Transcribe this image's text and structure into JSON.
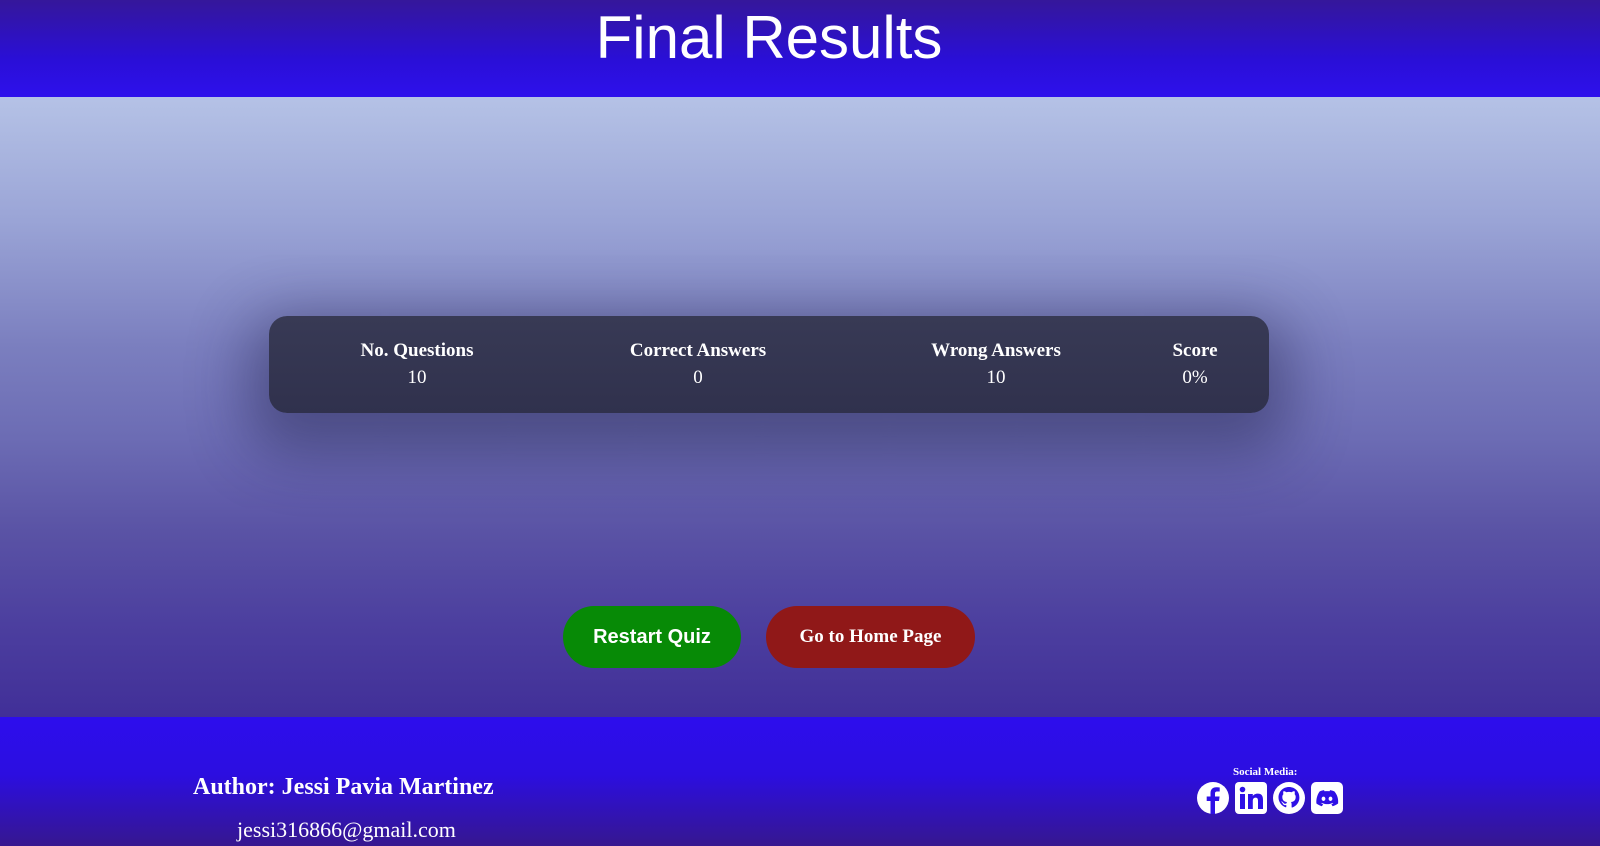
{
  "header": {
    "title": "Final Results"
  },
  "results": {
    "stats": [
      {
        "label": "No. Questions",
        "value": "10"
      },
      {
        "label": "Correct Answers",
        "value": "0"
      },
      {
        "label": "Wrong Answers",
        "value": "10"
      },
      {
        "label": "Score",
        "value": "0%"
      }
    ]
  },
  "actions": {
    "restart_label": "Restart Quiz",
    "home_label": "Go to Home Page",
    "restart_color": "#078a06",
    "home_color": "#901818"
  },
  "footer": {
    "author": "Author: Jessi Pavia Martinez",
    "email": "jessi316866@gmail.com",
    "social_label": "Social Media:",
    "social_icons": [
      "facebook-icon",
      "linkedin-icon",
      "github-icon",
      "discord-icon"
    ]
  },
  "colors": {
    "header_bg": "#2e10ec",
    "card_bg": "#34354f"
  }
}
